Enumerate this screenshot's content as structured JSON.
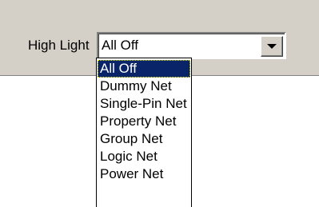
{
  "toolbar": {
    "highlight_label": "High Light",
    "highlight_value": "All Off"
  },
  "dropdown": {
    "options": [
      {
        "label": "All Off",
        "selected": true
      },
      {
        "label": "Dummy Net",
        "selected": false
      },
      {
        "label": "Single-Pin Net",
        "selected": false
      },
      {
        "label": "Property Net",
        "selected": false
      },
      {
        "label": "Group Net",
        "selected": false
      },
      {
        "label": "Logic Net",
        "selected": false
      },
      {
        "label": "Power Net",
        "selected": false
      }
    ]
  },
  "icons": {
    "combo_button": "chevron-down-icon"
  },
  "colors": {
    "toolbar_background": "#d4d0c8",
    "selection_background": "#0a246a",
    "selection_text": "#ffffff"
  }
}
